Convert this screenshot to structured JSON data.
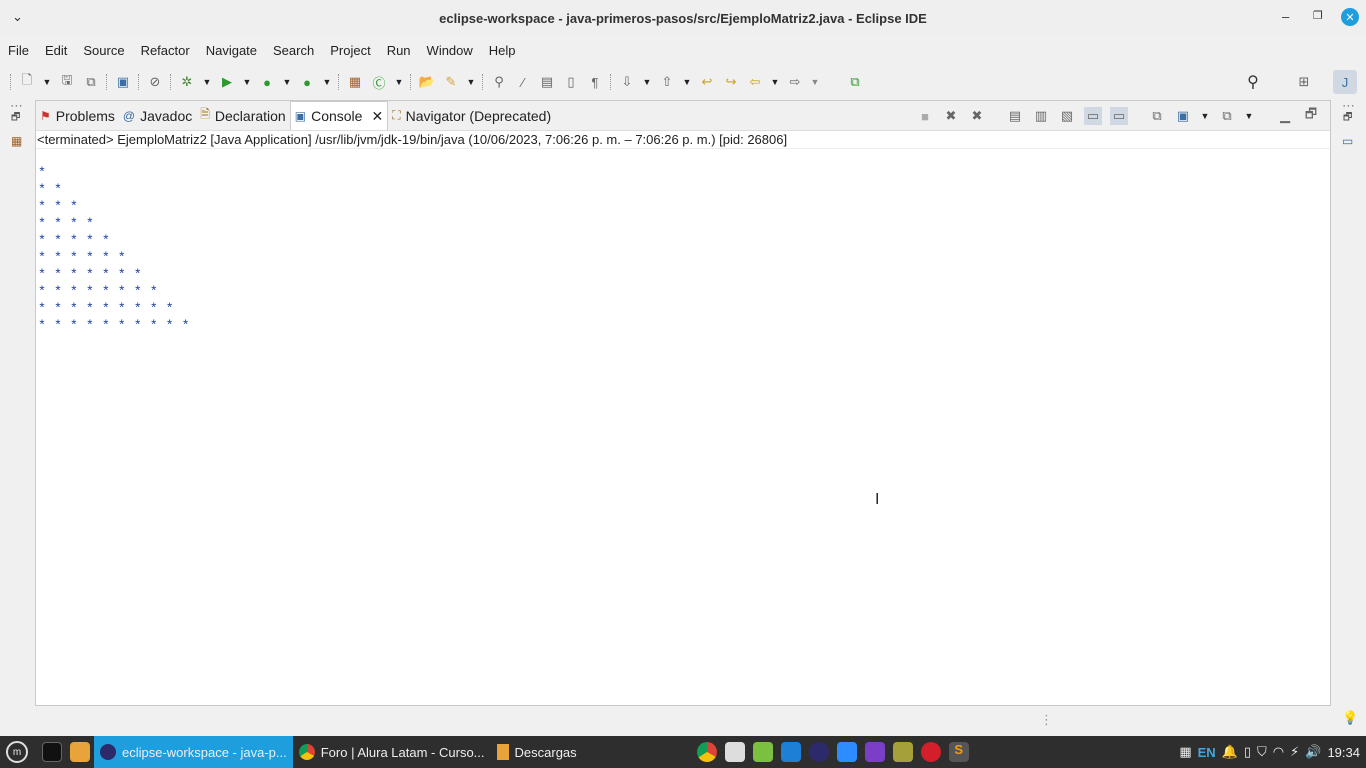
{
  "window": {
    "title": "eclipse-workspace - java-primeros-pasos/src/EjemploMatriz2.java - Eclipse IDE"
  },
  "menu": [
    "File",
    "Edit",
    "Source",
    "Refactor",
    "Navigate",
    "Search",
    "Project",
    "Run",
    "Window",
    "Help"
  ],
  "tabs": [
    {
      "label": "Problems",
      "icon": "problems-icon"
    },
    {
      "label": "Javadoc",
      "icon": "at-icon"
    },
    {
      "label": "Declaration",
      "icon": "declaration-icon"
    },
    {
      "label": "Console",
      "icon": "console-icon",
      "active": true
    },
    {
      "label": "Navigator (Deprecated)",
      "icon": "navigator-icon"
    }
  ],
  "console": {
    "status": "<terminated> EjemploMatriz2 [Java Application] /usr/lib/jvm/jdk-19/bin/java  (10/06/2023, 7:06:26 p. m. – 7:06:26 p. m.) [pid: 26806]",
    "lines": [
      "*",
      "* *",
      "* * *",
      "* * * *",
      "* * * * *",
      "* * * * * *",
      "* * * * * * *",
      "* * * * * * * *",
      "* * * * * * * * *",
      "* * * * * * * * * *"
    ]
  },
  "taskbar": {
    "items": [
      {
        "label": "eclipse-workspace - java-p...",
        "active": true
      },
      {
        "label": "Foro | Alura Latam - Curso..."
      },
      {
        "label": "Descargas"
      }
    ],
    "lang": "EN",
    "clock": "19:34"
  },
  "colors": {
    "accent": "#1f9ede",
    "console_text": "#1a3ca8",
    "taskbar": "#2e2e2e"
  }
}
